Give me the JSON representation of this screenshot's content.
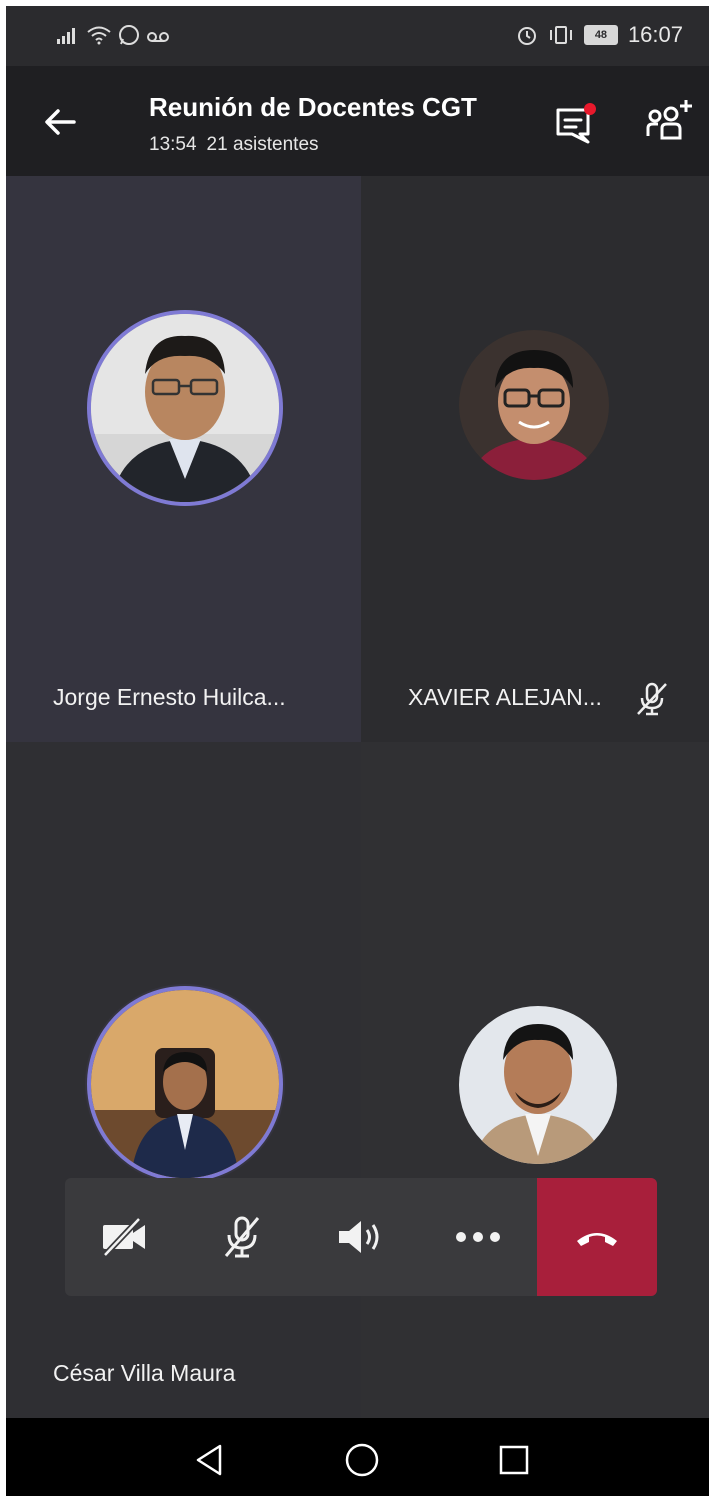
{
  "status_bar": {
    "time": "16:07",
    "battery": "48",
    "icons": [
      "signal-icon",
      "wifi-icon",
      "whatsapp-icon",
      "voicemail-icon",
      "alarm-icon",
      "vibrate-icon",
      "battery-icon"
    ]
  },
  "header": {
    "title": "Reunión de Docentes CGT",
    "duration": "13:54",
    "attendees": "21 asistentes",
    "chat_unread": true
  },
  "participants": [
    {
      "name": "Jorge Ernesto Huilca...",
      "muted": false,
      "speaking": true
    },
    {
      "name": "XAVIER ALEJAN...",
      "muted": true,
      "speaking": false
    },
    {
      "name": "César Villa Maura",
      "muted": false,
      "speaking": true
    },
    {
      "name": "",
      "muted": false,
      "speaking": false
    }
  ],
  "controls": {
    "items": [
      "camera-off-icon",
      "mic-off-icon",
      "speaker-icon",
      "more-icon",
      "hang-up-icon"
    ]
  },
  "colors": {
    "accent_ring": "#7f7ad4",
    "hangup": "#a81f3b",
    "unread_dot": "#e8192c",
    "header_bg": "#1f1f22"
  }
}
